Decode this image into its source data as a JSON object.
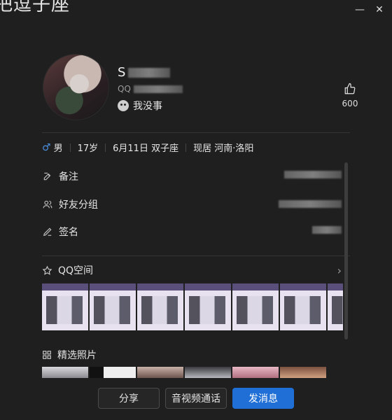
{
  "window": {
    "partial_title": "把逗子座",
    "minimize_label": "—",
    "close_label": "✕"
  },
  "profile": {
    "name_visible": "S",
    "qq_prefix": "QQ",
    "status": "我没事",
    "likes": "600"
  },
  "info": {
    "gender": "男",
    "age": "17岁",
    "birthday": "6月11日 双子座",
    "location": "现居 河南·洛阳"
  },
  "fields": [
    {
      "label": "备注",
      "icon": "edit-icon"
    },
    {
      "label": "好友分组",
      "icon": "group-icon"
    },
    {
      "label": "签名",
      "icon": "pen-icon"
    }
  ],
  "qzone": {
    "title": "QQ空间",
    "thumb_count": 7
  },
  "photos": {
    "title": "精选照片"
  },
  "actions": {
    "share": "分享",
    "call": "音视频通话",
    "message": "发消息"
  },
  "colors": {
    "accent": "#1f6fd6",
    "background": "#1f1f1f",
    "gender": "#4a90e2"
  }
}
